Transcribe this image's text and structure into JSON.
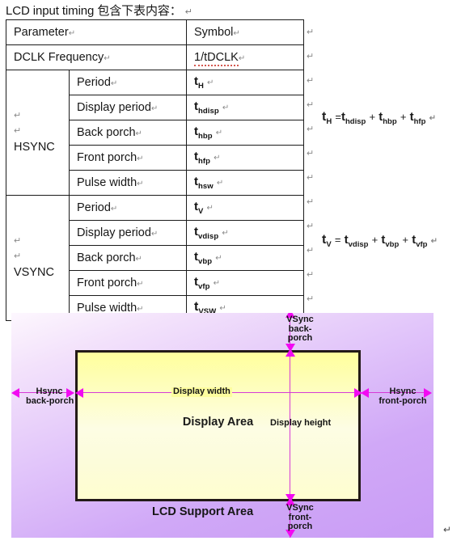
{
  "heading": {
    "text": "LCD input timing 包含下表内容：",
    "pilcrow": "↵"
  },
  "table": {
    "headers": {
      "parameter": "Parameter",
      "symbol": "Symbol"
    },
    "rows": [
      {
        "group": "",
        "param": "Parameter",
        "symbol": "Symbol",
        "symbol_sub": "",
        "kind": "header"
      },
      {
        "group": "",
        "param": "DCLK Frequency",
        "symbol": "1/tDCLK",
        "symbol_sub": "",
        "kind": "wide"
      },
      {
        "group": "",
        "param": "Period",
        "symbol": "t",
        "symbol_sub": "H",
        "kind": "sub"
      },
      {
        "group": "",
        "param": "Display period",
        "symbol": "t",
        "symbol_sub": "hdisp",
        "kind": "sub"
      },
      {
        "group": "HSYNC",
        "param": "Back porch",
        "symbol": "t",
        "symbol_sub": "hbp",
        "kind": "sub"
      },
      {
        "group": "",
        "param": "Front porch",
        "symbol": "t",
        "symbol_sub": "hfp",
        "kind": "sub"
      },
      {
        "group": "",
        "param": "Pulse width",
        "symbol": "t",
        "symbol_sub": "hsw",
        "kind": "sub"
      },
      {
        "group": "",
        "param": "Period",
        "symbol": "t",
        "symbol_sub": "V",
        "kind": "sub"
      },
      {
        "group": "",
        "param": "Display period",
        "symbol": "t",
        "symbol_sub": "vdisp",
        "kind": "sub"
      },
      {
        "group": "VSYNC",
        "param": "Back porch",
        "symbol": "t",
        "symbol_sub": "vbp",
        "kind": "sub"
      },
      {
        "group": "",
        "param": "Front porch",
        "symbol": "t",
        "symbol_sub": "vfp",
        "kind": "sub"
      },
      {
        "group": "",
        "param": "Pulse width",
        "symbol": "t",
        "symbol_sub": "vsw",
        "kind": "sub"
      }
    ],
    "row_mark": "↵"
  },
  "formulas": {
    "h": {
      "lhs": "t",
      "lhs_sub": "H",
      "eq": "=",
      "t1": "t",
      "t1_sub": "hdisp",
      "plus1": "+",
      "t2": "t",
      "t2_sub": "hbp",
      "plus2": "+",
      "t3": "t",
      "t3_sub": "hfp",
      "pilcrow": "↵"
    },
    "v": {
      "lhs": "t",
      "lhs_sub": "V",
      "eq": "=",
      "t1": "t",
      "t1_sub": "vdisp",
      "plus1": "+",
      "t2": "t",
      "t2_sub": "vbp",
      "plus2": "+",
      "t3": "t",
      "t3_sub": "vfp",
      "pilcrow": "↵"
    }
  },
  "diagram": {
    "display_area_label": "Display Area",
    "lcd_support_label": "LCD  Support Area",
    "display_width_label": "Display width",
    "display_height_label": "Display height",
    "hsync_back_label": "Hsync\nback-porch",
    "hsync_back_line1": "Hsync",
    "hsync_back_line2": "back-porch",
    "hsync_front_line1": "Hsync",
    "hsync_front_line2": "front-porch",
    "vsync_back_line1": "VSync",
    "vsync_back_line2": "back-",
    "vsync_back_line3": "porch",
    "vsync_front_line1": "VSync",
    "vsync_front_line2": "front-",
    "vsync_front_line3": "porch",
    "colors": {
      "support_area_start": "#fdf7fe",
      "support_area_end": "#c99cf5",
      "display_area_start": "#ffff9c",
      "display_area_end": "#fffecf",
      "border": "#231a17",
      "arrow": "#f20af2",
      "line": "#d63ad6"
    }
  },
  "trailing_pilcrow": "↵"
}
